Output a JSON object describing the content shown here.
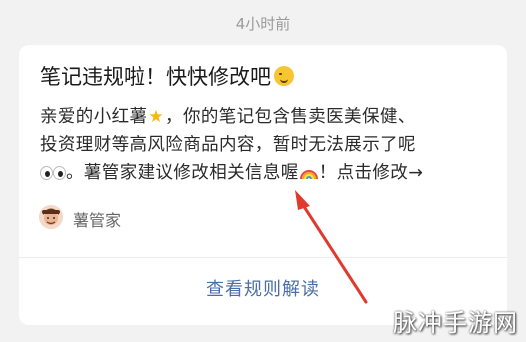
{
  "timestamp": "4小时前",
  "notice": {
    "title": "笔记违规啦！快快修改吧",
    "title_emoji": "winking-face-icon",
    "body_line1_a": "亲爱的小红薯",
    "body_line1_b": "，你的笔记包含售卖医美保健、",
    "body_line2": "投资理财等高风险商品内容，暂时无法展示了呢",
    "body_line3_a": "。薯管家建议修改相关信息喔",
    "body_line3_b": "！点击修改→",
    "author": "薯管家",
    "rules_link": "查看规则解读"
  },
  "colors": {
    "background": "#f2f2f2",
    "card": "#ffffff",
    "link": "#4a6fa5",
    "annotation_arrow": "#e03a2e"
  },
  "watermark": "脉冲手游网"
}
